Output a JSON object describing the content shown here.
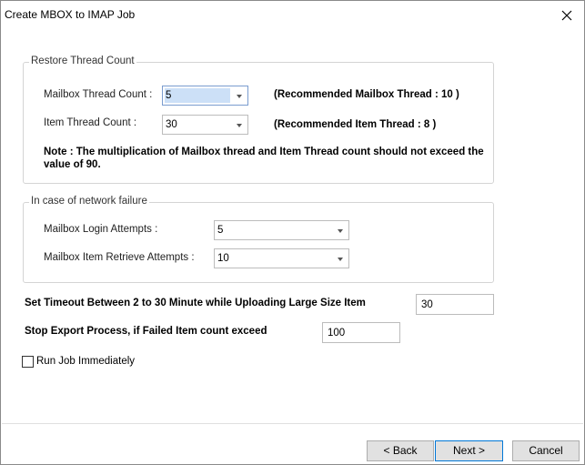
{
  "window": {
    "title": "Create MBOX to IMAP Job"
  },
  "restore_thread": {
    "group_label": "Restore Thread Count",
    "mailbox_thread_label": "Mailbox Thread Count :",
    "mailbox_thread_value": "5",
    "mailbox_thread_recommended": "(Recommended Mailbox Thread : 10 )",
    "item_thread_label": "Item Thread Count :",
    "item_thread_value": "30",
    "item_thread_recommended": "(Recommended Item Thread : 8 )",
    "note_line1": "Note : The multiplication of Mailbox thread  and Item Thread count should not exceed the",
    "note_line2": "value of 90."
  },
  "network_failure": {
    "group_label": "In case of network failure",
    "login_attempts_label": "Mailbox Login Attempts :",
    "login_attempts_value": "5",
    "retrieve_attempts_label": "Mailbox Item Retrieve Attempts :",
    "retrieve_attempts_value": "10"
  },
  "timeout": {
    "label": "Set Timeout Between 2 to 30 Minute while Uploading Large Size Item",
    "value": "30"
  },
  "stop_export": {
    "label": "Stop Export Process, if Failed Item count exceed",
    "value": "100"
  },
  "run_immediately": {
    "label": "Run Job Immediately",
    "checked": false
  },
  "buttons": {
    "back": "< Back",
    "next": "Next >",
    "cancel": "Cancel"
  }
}
